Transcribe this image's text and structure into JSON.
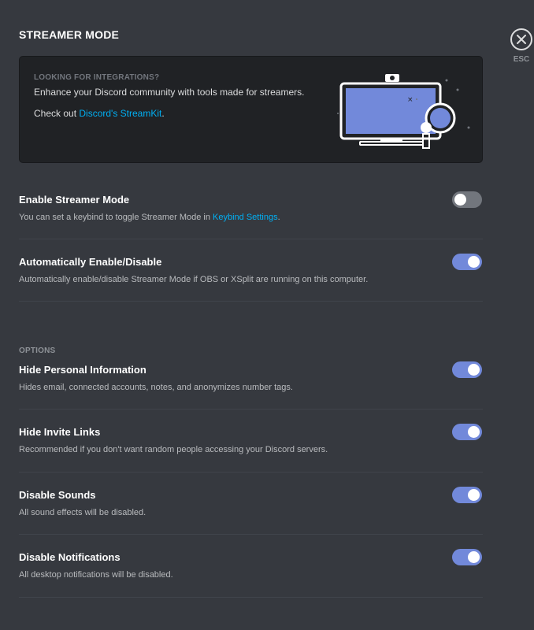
{
  "page": {
    "title": "STREAMER MODE",
    "close_label": "ESC"
  },
  "promo": {
    "eyebrow": "LOOKING FOR INTEGRATIONS?",
    "text": "Enhance your Discord community with tools made for streamers.",
    "link_prefix": "Check out ",
    "link_text": "Discord's StreamKit",
    "link_suffix": "."
  },
  "settings": {
    "enable": {
      "title": "Enable Streamer Mode",
      "desc_prefix": "You can set a keybind to toggle Streamer Mode in ",
      "desc_link": "Keybind Settings",
      "desc_suffix": ".",
      "enabled": false
    },
    "auto": {
      "title": "Automatically Enable/Disable",
      "desc": "Automatically enable/disable Streamer Mode if OBS or XSplit are running on this computer.",
      "enabled": true
    }
  },
  "options": {
    "label": "OPTIONS",
    "items": [
      {
        "title": "Hide Personal Information",
        "desc": "Hides email, connected accounts, notes, and anonymizes number tags.",
        "enabled": true
      },
      {
        "title": "Hide Invite Links",
        "desc": "Recommended if you don't want random people accessing your Discord servers.",
        "enabled": true
      },
      {
        "title": "Disable Sounds",
        "desc": "All sound effects will be disabled.",
        "enabled": true
      },
      {
        "title": "Disable Notifications",
        "desc": "All desktop notifications will be disabled.",
        "enabled": true
      }
    ]
  },
  "colors": {
    "background": "#36393f",
    "card": "#202225",
    "accent": "#7289da",
    "link": "#00b0f4",
    "toggle_off": "#72767d"
  }
}
